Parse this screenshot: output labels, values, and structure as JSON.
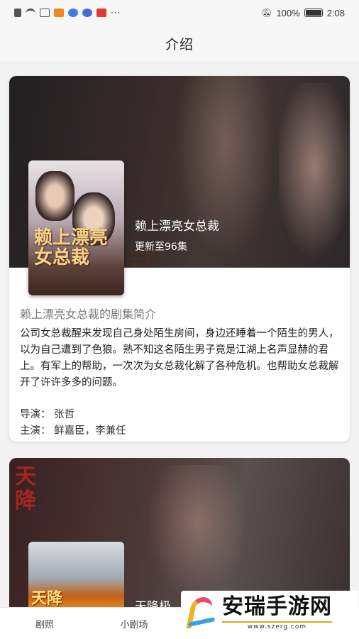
{
  "status_bar": {
    "battery": "100%",
    "time": "2:08",
    "notification_icons": [
      "warning-icon",
      "wifi-icon",
      "app-icon",
      "video-icon",
      "browser-icon",
      "music-icon",
      "mail-icon",
      "more-icon"
    ]
  },
  "header": {
    "title": "介绍"
  },
  "drama": {
    "title": "赖上漂亮女总裁",
    "update": "更新至96集",
    "poster_text": "赖上漂亮女总裁",
    "summary_heading": "赖上漂亮女总裁的剧集简介",
    "summary": "公司女总裁醒来发现自己身处陌生房间，身边还睡着一个陌生的男人，以为自己遭到了色狼。熟不知这名陌生男子竟是江湖上名声显赫的君上。有军上的帮助，一次次为女总裁化解了各种危机。也帮助女总裁解开了许许多多的问题。",
    "director": "导演： 张哲",
    "cast": "主演： 鲜嘉臣，李兼任"
  },
  "next_drama": {
    "art_text": "天降",
    "poster_text": "天降",
    "title_peek": "天降极"
  },
  "bottom_nav": {
    "items": [
      "剧照",
      "小剧场",
      "",
      ""
    ]
  },
  "watermark": {
    "name": "安瑞手游网",
    "url": "www.szerg.com"
  },
  "colors": {
    "accent": "#f0b020",
    "brand_pink": "#e84c6a",
    "brand_blue": "#3aa0e0"
  }
}
